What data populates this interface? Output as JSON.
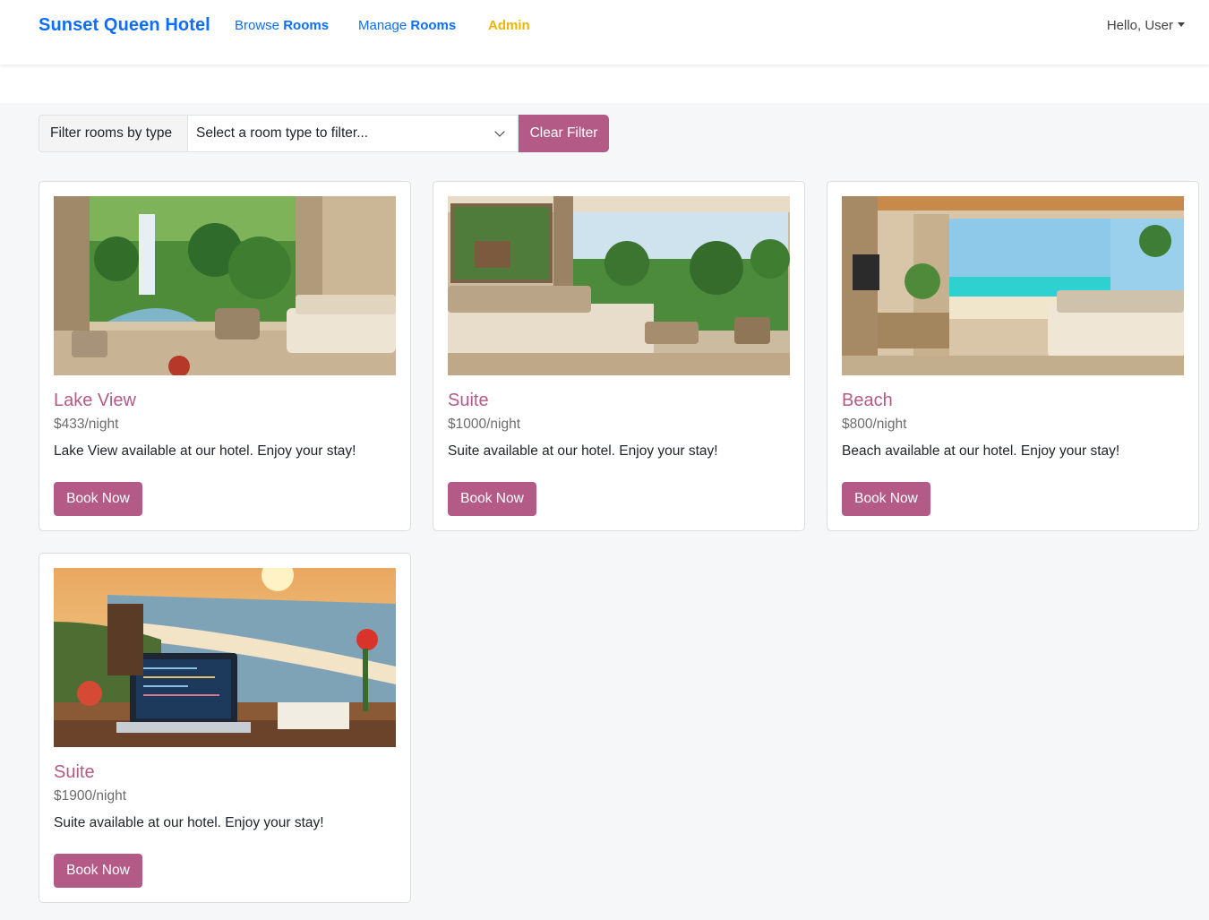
{
  "navbar": {
    "brand": "Sunset Queen Hotel",
    "browse_prefix": "Browse",
    "browse_bold": "Rooms",
    "manage_prefix": "Manage",
    "manage_bold": "Rooms",
    "admin": "Admin",
    "user_greeting": "Hello, User"
  },
  "filter": {
    "label": "Filter rooms by type",
    "selected": "Select a room type to filter...",
    "clear_label": "Clear Filter"
  },
  "rooms": [
    {
      "title": "Lake View",
      "price": "$433/night",
      "description": "Lake View available at our hotel. Enjoy your stay!",
      "button": "Book Now"
    },
    {
      "title": "Suite",
      "price": "$1000/night",
      "description": "Suite available at our hotel. Enjoy your stay!",
      "button": "Book Now"
    },
    {
      "title": "Beach",
      "price": "$800/night",
      "description": "Beach available at our hotel. Enjoy your stay!",
      "button": "Book Now"
    },
    {
      "title": "Suite",
      "price": "$1900/night",
      "description": "Suite available at our hotel. Enjoy your stay!",
      "button": "Book Now"
    }
  ],
  "colors": {
    "brand": "#0d6efd",
    "admin": "#f0b400",
    "accent": "#b45a86"
  }
}
